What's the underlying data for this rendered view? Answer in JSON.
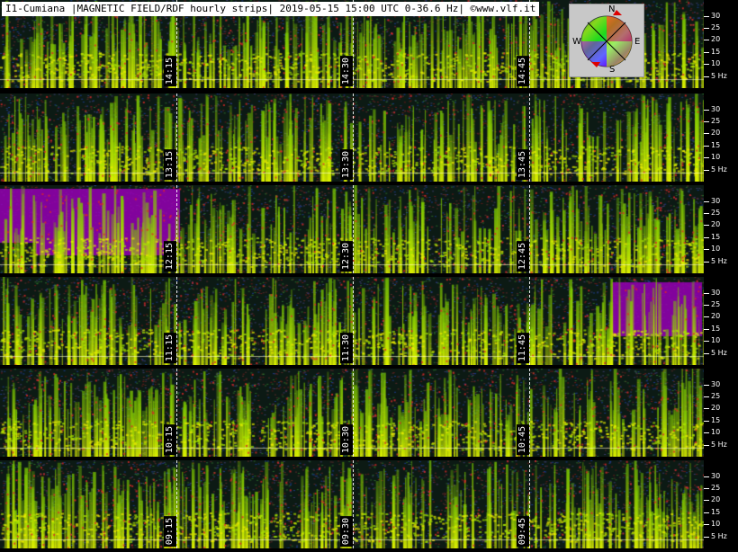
{
  "header": {
    "title": "I1-Cumiana |MAGNETIC FIELD/RDF hourly strips| 2019-05-15 15:00 UTC 0-36.6 Hz| ©www.vlf.it"
  },
  "compass": {
    "n": "N",
    "e": "E",
    "s": "S",
    "w": "W"
  },
  "axis": {
    "ticks": [
      "30",
      "25",
      "20",
      "15",
      "10",
      "5 Hz"
    ],
    "tick_values_hz": [
      30,
      25,
      20,
      15,
      10,
      5
    ],
    "max_hz": 36.6
  },
  "strips": [
    {
      "hour": "14",
      "markers": [
        "14:15",
        "14:30",
        "14:45"
      ]
    },
    {
      "hour": "13",
      "markers": [
        "13:15",
        "13:30",
        "13:45"
      ]
    },
    {
      "hour": "12",
      "markers": [
        "12:15",
        "12:30",
        "12:45"
      ]
    },
    {
      "hour": "11",
      "markers": [
        "11:15",
        "11:30",
        "11:45"
      ]
    },
    {
      "hour": "10",
      "markers": [
        "10:15",
        "10:30",
        "10:45"
      ]
    },
    {
      "hour": "09",
      "markers": [
        "09:15",
        "09:30",
        "09:45"
      ]
    }
  ],
  "colors": {
    "background": "#000000",
    "grass": "#b4e600",
    "yellow": "#f0f000",
    "purple": "#9600b4"
  }
}
